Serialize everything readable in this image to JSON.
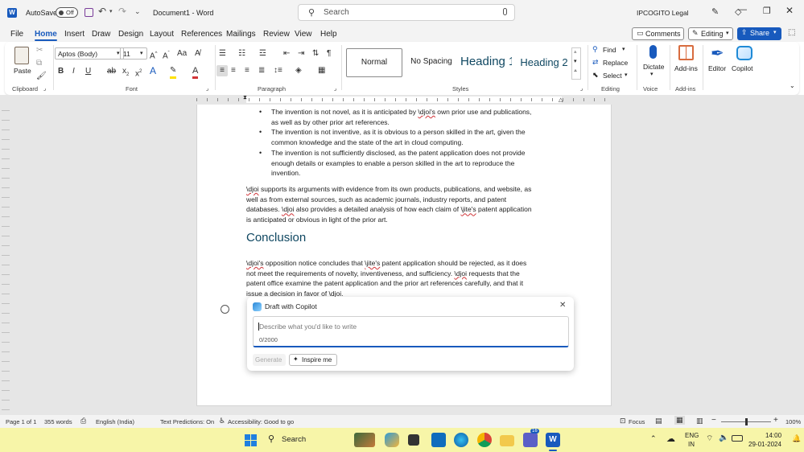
{
  "titlebar": {
    "autosave_label": "AutoSave",
    "autosave_state": "Off",
    "doc_title": "Document1 - Word",
    "search_placeholder": "Search",
    "account": "IPCOGITO Legal"
  },
  "tabs": [
    "File",
    "Home",
    "Insert",
    "Draw",
    "Design",
    "Layout",
    "References",
    "Mailings",
    "Review",
    "View",
    "Help"
  ],
  "tabs_right": {
    "comments": "Comments",
    "editing": "Editing",
    "share": "Share"
  },
  "ribbon": {
    "clipboard": {
      "paste": "Paste",
      "label": "Clipboard"
    },
    "font": {
      "name": "Aptos (Body)",
      "size": "11",
      "label": "Font"
    },
    "paragraph": {
      "label": "Paragraph"
    },
    "styles": {
      "items": [
        "Normal",
        "No Spacing",
        "Heading 1",
        "Heading 2"
      ],
      "label": "Styles"
    },
    "editing": {
      "find": "Find",
      "replace": "Replace",
      "select": "Select",
      "label": "Editing"
    },
    "voice": {
      "dictate": "Dictate",
      "label": "Voice"
    },
    "addins": {
      "addins": "Add-ins",
      "editor": "Editor",
      "copilot": "Copilot",
      "label": "Add-ins"
    }
  },
  "document": {
    "bullets": [
      [
        "The invention is not novel, as it is anticipated by ",
        "\\djoi's",
        " own prior use and publications,",
        "as well as by other prior art references."
      ],
      [
        "The invention is not inventive, as it is obvious to a person skilled in the art, given the",
        "common knowledge and the state of the art in cloud computing."
      ],
      [
        "The invention is not sufficiently disclosed, as the patent application does not provide",
        "enough details or examples to enable a person skilled in the art to reproduce the",
        "invention."
      ]
    ],
    "para1": {
      "l1a": "\\djoi",
      "l1b": " supports its arguments with evidence from its own products, publications, and website, as",
      "l2": "well as from external sources, such as academic journals, industry reports, and patent",
      "l3a": "databases. ",
      "l3b": "\\djoi",
      "l3c": " also provides a detailed analysis of how each claim of ",
      "l3d": "\\jite's",
      "l3e": " patent application",
      "l4": "is anticipated or obvious in light of the prior art."
    },
    "heading": "Conclusion",
    "para2": {
      "l1a": "\\djoi's",
      "l1b": " opposition notice concludes that ",
      "l1c": "\\jite's",
      "l1d": " patent application should be rejected, as it does",
      "l2a": "not meet the requirements of novelty, inventiveness, and sufficiency. ",
      "l2b": "\\djoi",
      "l2c": " requests that the",
      "l3": "patent office examine the patent application and the prior art references carefully, and that it",
      "l4a": "issue a decision in ",
      "l4b": "favor",
      "l4c": " of ",
      "l4d": "\\djoi",
      "l4e": "."
    }
  },
  "copilot": {
    "title": "Draft with Copilot",
    "placeholder": "Describe what you'd like to write",
    "counter": "0/2000",
    "generate": "Generate",
    "inspire": "Inspire me"
  },
  "status": {
    "page": "Page 1 of 1",
    "words": "355 words",
    "language": "English (India)",
    "predictions": "Text Predictions: On",
    "accessibility": "Accessibility: Good to go",
    "focus": "Focus",
    "zoom": "100%"
  },
  "taskbar": {
    "search": "Search",
    "lang1": "ENG",
    "lang2": "IN",
    "time": "14:00",
    "date": "29-01-2024",
    "badge": "16"
  },
  "colors": {
    "accent": "#185abd",
    "heading": "#0f4761",
    "taskbar": "#f7f5a8"
  }
}
